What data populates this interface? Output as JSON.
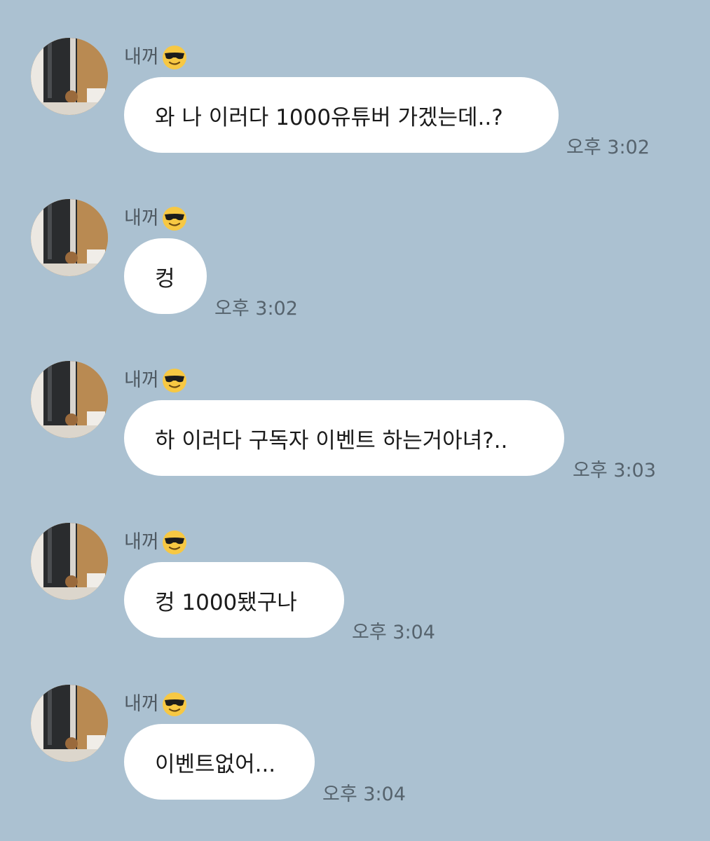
{
  "colors": {
    "background": "#abc1d1",
    "bubble": "#ffffff",
    "sender_text": "#4f5a63",
    "time_text": "#56636d"
  },
  "messages": [
    {
      "sender": "내꺼",
      "sender_emoji": "smiling-face-with-sunglasses-icon",
      "text": "와 나 이러다 1000유튜버 가겠는데..?",
      "time": "오후 3:02"
    },
    {
      "sender": "내꺼",
      "sender_emoji": "smiling-face-with-sunglasses-icon",
      "text": "컹",
      "time": "오후 3:02"
    },
    {
      "sender": "내꺼",
      "sender_emoji": "smiling-face-with-sunglasses-icon",
      "text": "하 이러다 구독자 이벤트 하는거아녀?..",
      "time": "오후 3:03"
    },
    {
      "sender": "내꺼",
      "sender_emoji": "smiling-face-with-sunglasses-icon",
      "text": "컹 1000됐구나",
      "time": "오후 3:04"
    },
    {
      "sender": "내꺼",
      "sender_emoji": "smiling-face-with-sunglasses-icon",
      "text": "이벤트없어...",
      "time": "오후 3:04"
    }
  ]
}
